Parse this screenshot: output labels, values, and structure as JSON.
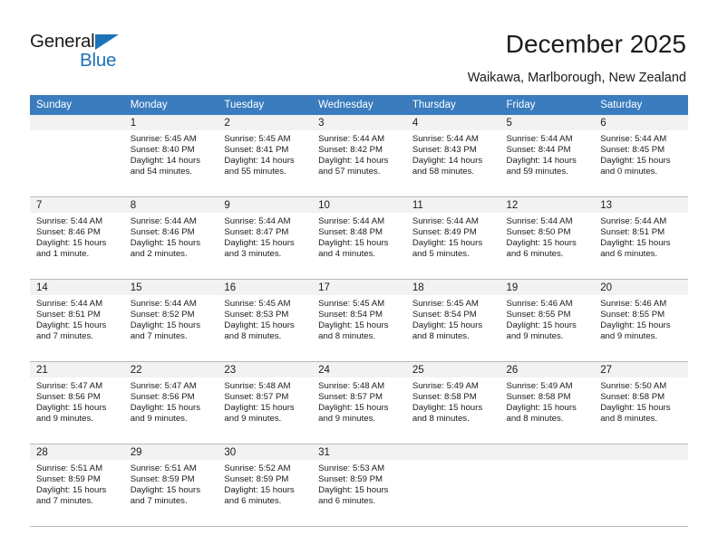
{
  "brand": {
    "name_top": "General",
    "name_bottom": "Blue",
    "triangle_icon": "triangle-icon",
    "accent_color": "#1b72b8"
  },
  "header": {
    "title": "December 2025",
    "subtitle": "Waikawa, Marlborough, New Zealand"
  },
  "calendar": {
    "header_bg": "#3a7cbe",
    "daynum_bg": "#f2f2f2",
    "weekdays": [
      "Sunday",
      "Monday",
      "Tuesday",
      "Wednesday",
      "Thursday",
      "Friday",
      "Saturday"
    ],
    "weeks": [
      [
        {
          "day": "",
          "lines": []
        },
        {
          "day": "1",
          "lines": [
            "Sunrise: 5:45 AM",
            "Sunset: 8:40 PM",
            "Daylight: 14 hours",
            "and 54 minutes."
          ]
        },
        {
          "day": "2",
          "lines": [
            "Sunrise: 5:45 AM",
            "Sunset: 8:41 PM",
            "Daylight: 14 hours",
            "and 55 minutes."
          ]
        },
        {
          "day": "3",
          "lines": [
            "Sunrise: 5:44 AM",
            "Sunset: 8:42 PM",
            "Daylight: 14 hours",
            "and 57 minutes."
          ]
        },
        {
          "day": "4",
          "lines": [
            "Sunrise: 5:44 AM",
            "Sunset: 8:43 PM",
            "Daylight: 14 hours",
            "and 58 minutes."
          ]
        },
        {
          "day": "5",
          "lines": [
            "Sunrise: 5:44 AM",
            "Sunset: 8:44 PM",
            "Daylight: 14 hours",
            "and 59 minutes."
          ]
        },
        {
          "day": "6",
          "lines": [
            "Sunrise: 5:44 AM",
            "Sunset: 8:45 PM",
            "Daylight: 15 hours",
            "and 0 minutes."
          ]
        }
      ],
      [
        {
          "day": "7",
          "lines": [
            "Sunrise: 5:44 AM",
            "Sunset: 8:46 PM",
            "Daylight: 15 hours",
            "and 1 minute."
          ]
        },
        {
          "day": "8",
          "lines": [
            "Sunrise: 5:44 AM",
            "Sunset: 8:46 PM",
            "Daylight: 15 hours",
            "and 2 minutes."
          ]
        },
        {
          "day": "9",
          "lines": [
            "Sunrise: 5:44 AM",
            "Sunset: 8:47 PM",
            "Daylight: 15 hours",
            "and 3 minutes."
          ]
        },
        {
          "day": "10",
          "lines": [
            "Sunrise: 5:44 AM",
            "Sunset: 8:48 PM",
            "Daylight: 15 hours",
            "and 4 minutes."
          ]
        },
        {
          "day": "11",
          "lines": [
            "Sunrise: 5:44 AM",
            "Sunset: 8:49 PM",
            "Daylight: 15 hours",
            "and 5 minutes."
          ]
        },
        {
          "day": "12",
          "lines": [
            "Sunrise: 5:44 AM",
            "Sunset: 8:50 PM",
            "Daylight: 15 hours",
            "and 6 minutes."
          ]
        },
        {
          "day": "13",
          "lines": [
            "Sunrise: 5:44 AM",
            "Sunset: 8:51 PM",
            "Daylight: 15 hours",
            "and 6 minutes."
          ]
        }
      ],
      [
        {
          "day": "14",
          "lines": [
            "Sunrise: 5:44 AM",
            "Sunset: 8:51 PM",
            "Daylight: 15 hours",
            "and 7 minutes."
          ]
        },
        {
          "day": "15",
          "lines": [
            "Sunrise: 5:44 AM",
            "Sunset: 8:52 PM",
            "Daylight: 15 hours",
            "and 7 minutes."
          ]
        },
        {
          "day": "16",
          "lines": [
            "Sunrise: 5:45 AM",
            "Sunset: 8:53 PM",
            "Daylight: 15 hours",
            "and 8 minutes."
          ]
        },
        {
          "day": "17",
          "lines": [
            "Sunrise: 5:45 AM",
            "Sunset: 8:54 PM",
            "Daylight: 15 hours",
            "and 8 minutes."
          ]
        },
        {
          "day": "18",
          "lines": [
            "Sunrise: 5:45 AM",
            "Sunset: 8:54 PM",
            "Daylight: 15 hours",
            "and 8 minutes."
          ]
        },
        {
          "day": "19",
          "lines": [
            "Sunrise: 5:46 AM",
            "Sunset: 8:55 PM",
            "Daylight: 15 hours",
            "and 9 minutes."
          ]
        },
        {
          "day": "20",
          "lines": [
            "Sunrise: 5:46 AM",
            "Sunset: 8:55 PM",
            "Daylight: 15 hours",
            "and 9 minutes."
          ]
        }
      ],
      [
        {
          "day": "21",
          "lines": [
            "Sunrise: 5:47 AM",
            "Sunset: 8:56 PM",
            "Daylight: 15 hours",
            "and 9 minutes."
          ]
        },
        {
          "day": "22",
          "lines": [
            "Sunrise: 5:47 AM",
            "Sunset: 8:56 PM",
            "Daylight: 15 hours",
            "and 9 minutes."
          ]
        },
        {
          "day": "23",
          "lines": [
            "Sunrise: 5:48 AM",
            "Sunset: 8:57 PM",
            "Daylight: 15 hours",
            "and 9 minutes."
          ]
        },
        {
          "day": "24",
          "lines": [
            "Sunrise: 5:48 AM",
            "Sunset: 8:57 PM",
            "Daylight: 15 hours",
            "and 9 minutes."
          ]
        },
        {
          "day": "25",
          "lines": [
            "Sunrise: 5:49 AM",
            "Sunset: 8:58 PM",
            "Daylight: 15 hours",
            "and 8 minutes."
          ]
        },
        {
          "day": "26",
          "lines": [
            "Sunrise: 5:49 AM",
            "Sunset: 8:58 PM",
            "Daylight: 15 hours",
            "and 8 minutes."
          ]
        },
        {
          "day": "27",
          "lines": [
            "Sunrise: 5:50 AM",
            "Sunset: 8:58 PM",
            "Daylight: 15 hours",
            "and 8 minutes."
          ]
        }
      ],
      [
        {
          "day": "28",
          "lines": [
            "Sunrise: 5:51 AM",
            "Sunset: 8:59 PM",
            "Daylight: 15 hours",
            "and 7 minutes."
          ]
        },
        {
          "day": "29",
          "lines": [
            "Sunrise: 5:51 AM",
            "Sunset: 8:59 PM",
            "Daylight: 15 hours",
            "and 7 minutes."
          ]
        },
        {
          "day": "30",
          "lines": [
            "Sunrise: 5:52 AM",
            "Sunset: 8:59 PM",
            "Daylight: 15 hours",
            "and 6 minutes."
          ]
        },
        {
          "day": "31",
          "lines": [
            "Sunrise: 5:53 AM",
            "Sunset: 8:59 PM",
            "Daylight: 15 hours",
            "and 6 minutes."
          ]
        },
        {
          "day": "",
          "lines": []
        },
        {
          "day": "",
          "lines": []
        },
        {
          "day": "",
          "lines": []
        }
      ]
    ]
  }
}
